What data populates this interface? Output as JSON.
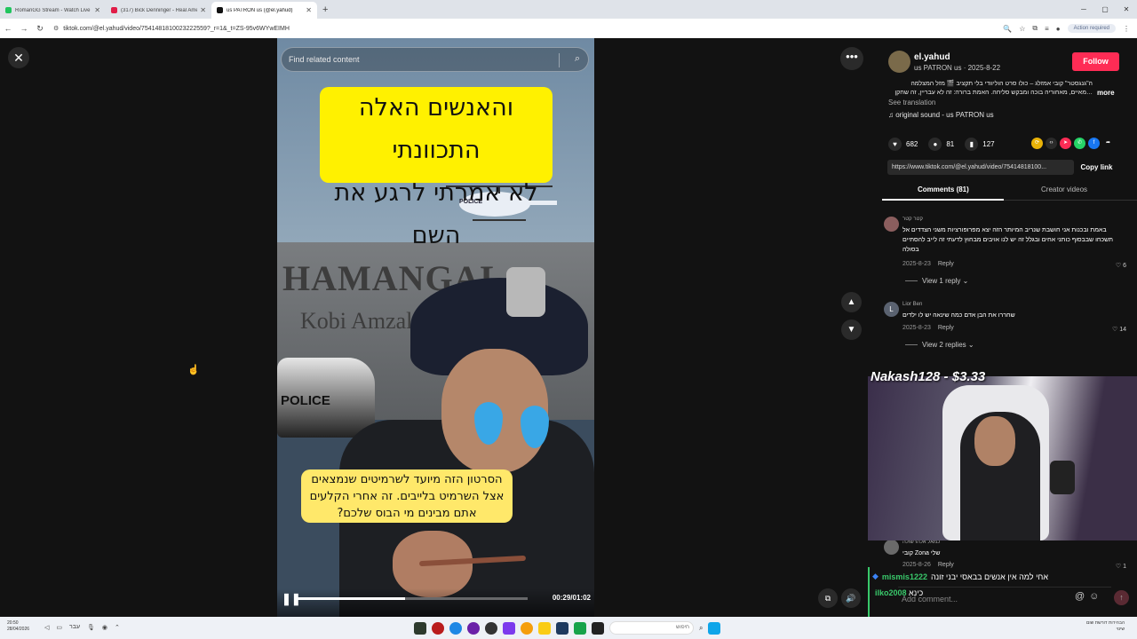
{
  "browser": {
    "tabs": [
      {
        "title": "RomanGG Stream - Watch Live",
        "color": "#22c55e",
        "active": false
      },
      {
        "title": "(317) Bick Denninger - Real Ame",
        "color": "#e11d48",
        "active": false
      },
      {
        "title": "us PATRON us (@el.yahud)",
        "color": "#111111",
        "active": true
      }
    ],
    "new_tab": "+",
    "url": "tiktok.com/@el.yahud/video/7541481810023222559?_r=1&_t=ZS-95v6WYwEIMH",
    "action_required": "Action required"
  },
  "video": {
    "search_placeholder": "Find related content",
    "banner_top_line1": "והאנשים האלה התכוונתי",
    "banner_top_line2": "לא אמרתי לרגע את השם",
    "banner_bottom_line1": "הסרטון הזה מיועד לשרמיטים שנמצאים",
    "banner_bottom_line2": "אצל השרמיט בלייבים. זה אחרי הקלעים",
    "banner_bottom_line3": "אתם מבינים מי הבוס שלכם?",
    "wall_text_1": "HAMANGAL",
    "wall_text_2": "Kobi Amzaleg",
    "car_label": "POLICE",
    "heli_label": "POLICE",
    "time": "00:29/01:02",
    "progress": 0.47
  },
  "panel": {
    "username": "el.yahud",
    "subline": "us PATRON us · 2025-8-22",
    "follow": "Follow",
    "description_line1": "ה\"גנגסטר\" קובי אמזלג – כולו סרט הוליוודי בלי תקציב 🎬 מזל המצלמה",
    "description_line2": "…מאיים, מאחוריה בוכה ומבקש סליחה. האמת ברורה: זה לא עבריין, זה שחקן",
    "more": "more",
    "see_translation": "See translation",
    "sound": "original sound - us PATRON us",
    "likes": "682",
    "comments": "81",
    "saves": "127",
    "link": "https://www.tiktok.com/@el.yahud/video/75414818100...",
    "copy_link": "Copy link",
    "tab_comments": "Comments (81)",
    "tab_creator": "Creator videos"
  },
  "comments": [
    {
      "user": "קטר קטר",
      "text": "באמת ובכנות אני חושבת שנריב המיותר הזה יצא מפרופורציות משני הצדדים אל תשכחו שבבסוף כותני אחים ובגלל זה יש לנו אויבים מבחוץ לדעתי זה לייב להסתיים בסולה",
      "date": "2025-8-23",
      "reply": "Reply",
      "likes": "6",
      "view_replies": "View 1 reply"
    },
    {
      "user": "Lior Ben",
      "initial": "L",
      "text": "שחררו את הבן אדם כמה שינאה יש לו ילדים",
      "date": "2025-8-23",
      "reply": "Reply",
      "likes": "14",
      "view_replies": "View 2 replies"
    },
    {
      "user": "כמאל אלהרשולה",
      "text": "שלי Zona קובי",
      "date": "2025-8-26",
      "reply": "Reply",
      "likes": "1"
    }
  ],
  "stream": {
    "label": "Nakash128 - $3.33",
    "chat1_name": "mismis1222",
    "chat1_text": "אחי למה אין אנשים בבאסי יבני זונה",
    "chat2_name": "ilko2008",
    "chat2_text": "כינא"
  },
  "add_comment_placeholder": "Add comment...",
  "taskbar": {
    "time": "20:50",
    "date": "28/04/2026",
    "lang": "עבר",
    "search_placeholder": "חיפוש",
    "right_text1": "הבהירות דורשת שום",
    "right_text2": "שינוי"
  }
}
